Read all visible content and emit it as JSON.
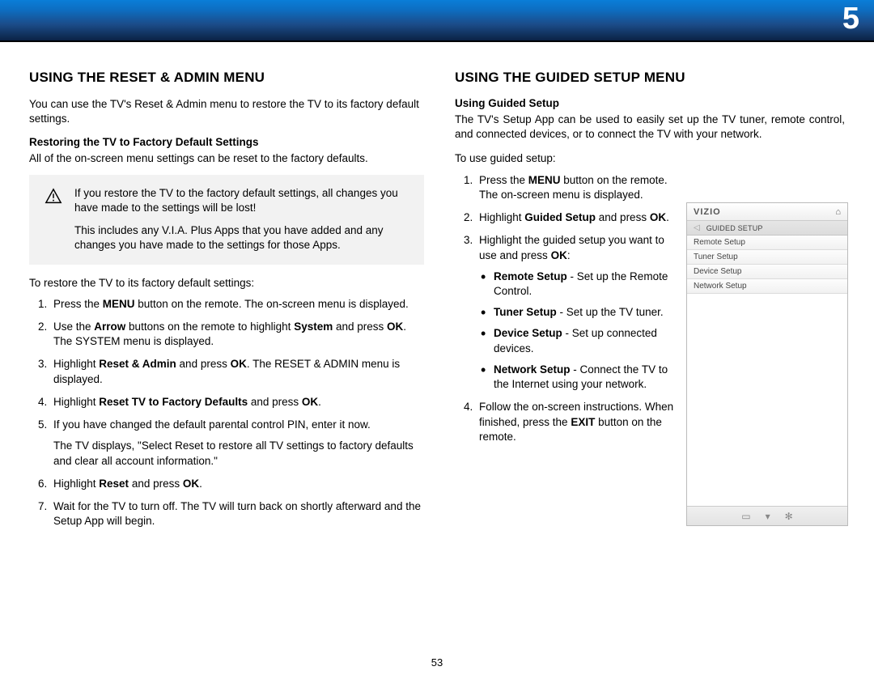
{
  "page_number_top": "5",
  "page_number_bottom": "53",
  "left": {
    "heading": "USING THE RESET & ADMIN MENU",
    "intro": "You can use the TV's Reset & Admin menu to restore the TV to its factory default settings.",
    "subhead": "Restoring the TV to Factory Default Settings",
    "subintro": "All of the on-screen menu settings can be reset to the factory defaults.",
    "callout_p1": "If you restore the TV to the factory default settings, all changes you have made to the settings will be lost!",
    "callout_p2": "This includes any V.I.A. Plus Apps that you have added and any changes you have made to the settings for those Apps.",
    "restore_intro": "To restore the TV to its factory default settings:",
    "steps": {
      "s1a": "Press the ",
      "s1b": "MENU",
      "s1c": " button on the remote. The on-screen menu is displayed.",
      "s2a": "Use the ",
      "s2b": "Arrow",
      "s2c": " buttons on the remote to highlight ",
      "s2d": "System",
      "s2e": " and press ",
      "s2f": "OK",
      "s2g": ". The SYSTEM menu is displayed.",
      "s3a": "Highlight ",
      "s3b": "Reset & Admin",
      "s3c": " and press ",
      "s3d": "OK",
      "s3e": ". The RESET & ADMIN menu is displayed.",
      "s4a": "Highlight ",
      "s4b": "Reset TV to Factory Defaults",
      "s4c": " and press ",
      "s4d": "OK",
      "s4e": ".",
      "s5": "If you have changed the default parental control PIN, enter it now.",
      "s5p": "The TV displays, \"Select Reset to restore all TV settings to factory defaults and clear all account information.\"",
      "s6a": "Highlight ",
      "s6b": "Reset",
      "s6c": " and press ",
      "s6d": "OK",
      "s6e": ".",
      "s7": "Wait for the TV to turn off. The TV will turn back on shortly afterward and the Setup App will begin."
    }
  },
  "right": {
    "heading": "USING THE GUIDED SETUP MENU",
    "subhead": "Using Guided Setup",
    "intro": "The TV's Setup App can be used to easily set up the TV tuner, remote control, and connected devices, or to connect the TV with your network.",
    "use_intro": "To use guided setup:",
    "steps": {
      "s1a": "Press the ",
      "s1b": "MENU",
      "s1c": " button on the remote. The on-screen menu is displayed.",
      "s2a": "Highlight ",
      "s2b": "Guided Setup",
      "s2c": " and press ",
      "s2d": "OK",
      "s2e": ".",
      "s3a": "Highlight the guided setup you want to use and press ",
      "s3b": "OK",
      "s3c": ":",
      "b1a": "Remote Setup",
      "b1b": " - Set up the Remote Control.",
      "b2a": "Tuner Setup",
      "b2b": " - Set up the TV tuner.",
      "b3a": "Device Setup",
      "b3b": " - Set up connected devices.",
      "b4a": "Network Setup",
      "b4b": " - Connect the TV to the Internet using your network.",
      "s4a": "Follow the on-screen instructions. When finished, press the ",
      "s4b": "EXIT",
      "s4c": " button on the remote."
    }
  },
  "osd": {
    "logo": "VIZIO",
    "title": "GUIDED SETUP",
    "items": [
      "Remote Setup",
      "Tuner Setup",
      "Device Setup",
      "Network Setup"
    ]
  }
}
